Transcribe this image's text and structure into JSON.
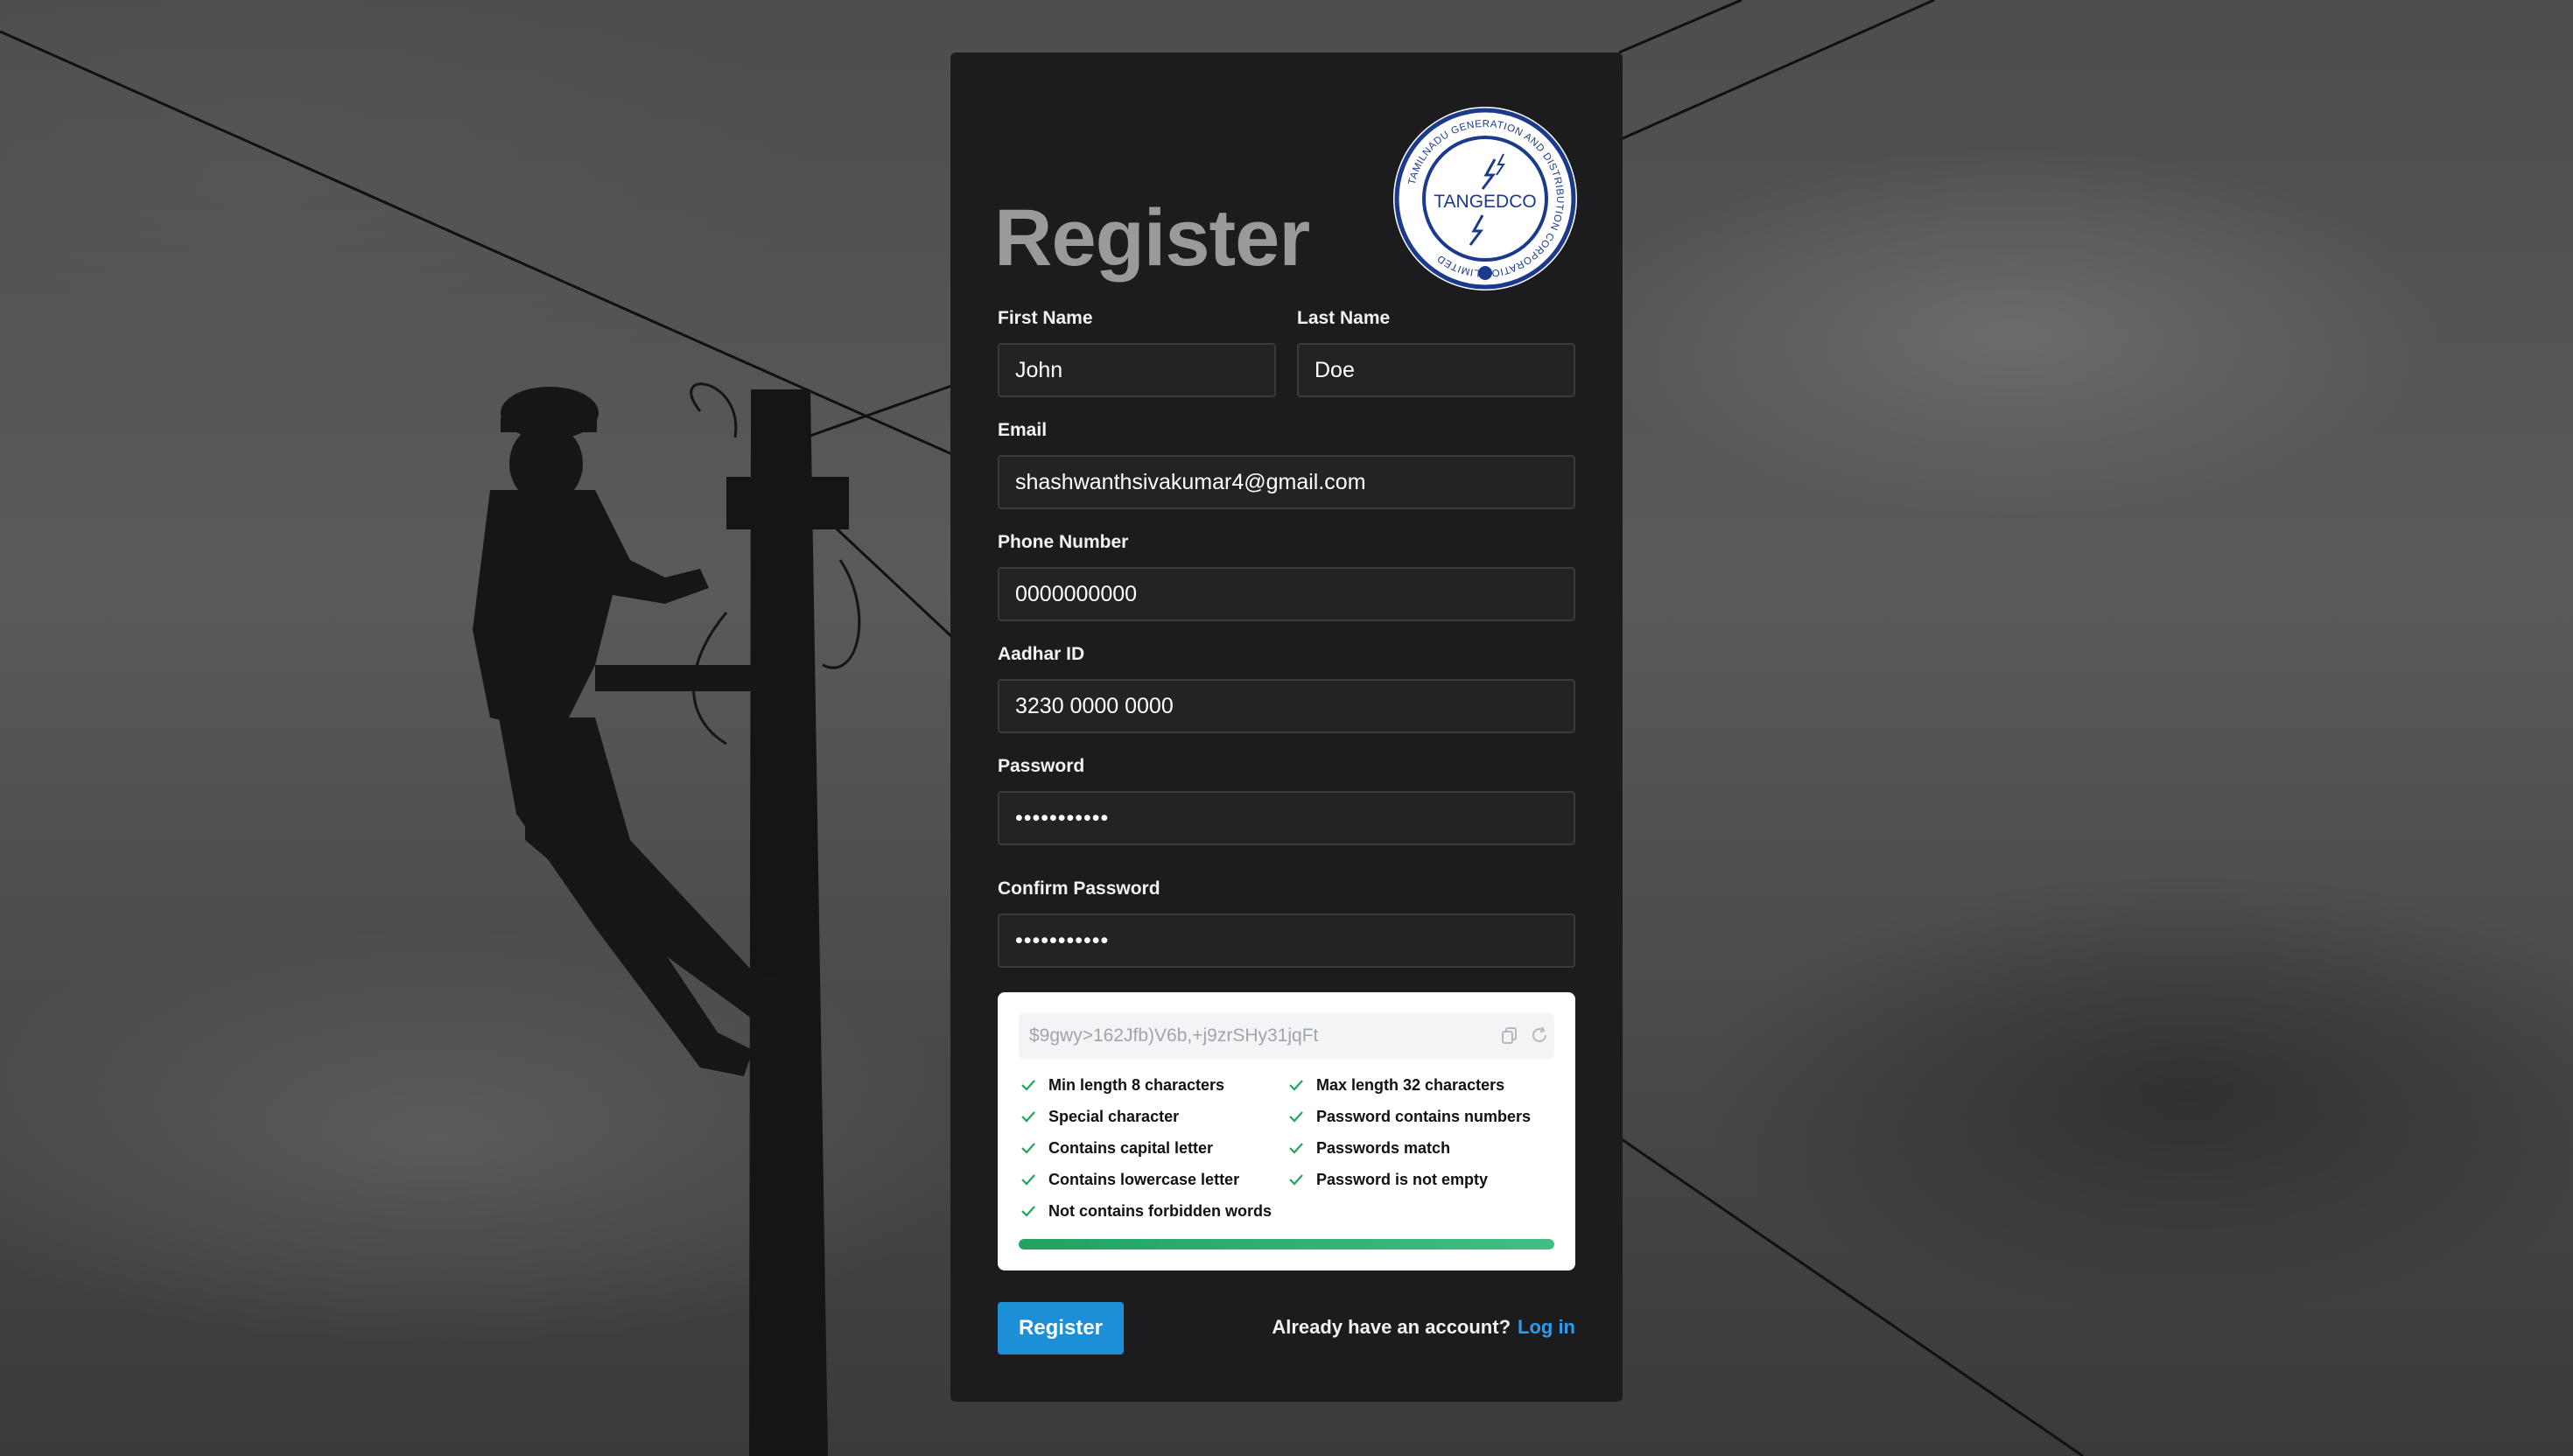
{
  "form": {
    "title": "Register",
    "logo": {
      "name": "TANGEDCO",
      "ring_text": "TAMILNADU GENERATION AND DISTRIBUTION CORPORATION LIMITED"
    },
    "fields": {
      "first_name": {
        "label": "First Name",
        "value": "John"
      },
      "last_name": {
        "label": "Last Name",
        "value": "Doe"
      },
      "email": {
        "label": "Email",
        "value": "shashwanthsivakumar4@gmail.com"
      },
      "phone": {
        "label": "Phone Number",
        "value": "0000000000"
      },
      "aadhar": {
        "label": "Aadhar ID",
        "value": "3230 0000 0000"
      },
      "password": {
        "label": "Password",
        "value": "•••••••••••"
      },
      "confirm_password": {
        "label": "Confirm Password",
        "value": "•••••••••••"
      }
    },
    "password_checker": {
      "generated_password": "$9gwy>162Jfb)V6b,+j9zrSHy31jqFt",
      "rules_left": [
        "Min length 8 characters",
        "Special character",
        "Contains capital letter",
        "Contains lowercase letter",
        "Not contains forbidden words"
      ],
      "rules_right": [
        "Max length 32 characters",
        "Password contains numbers",
        "Passwords match",
        "Password is not empty"
      ],
      "strength": 1.0,
      "check_color": "#1fa35e"
    },
    "register_button": "Register",
    "login_prompt": "Already have an account?",
    "login_link": "Log in"
  },
  "colors": {
    "card_bg": "#1c1c1e",
    "accent": "#1d8fd6",
    "link": "#2d9be8",
    "logo_blue": "#1b3a8c"
  }
}
